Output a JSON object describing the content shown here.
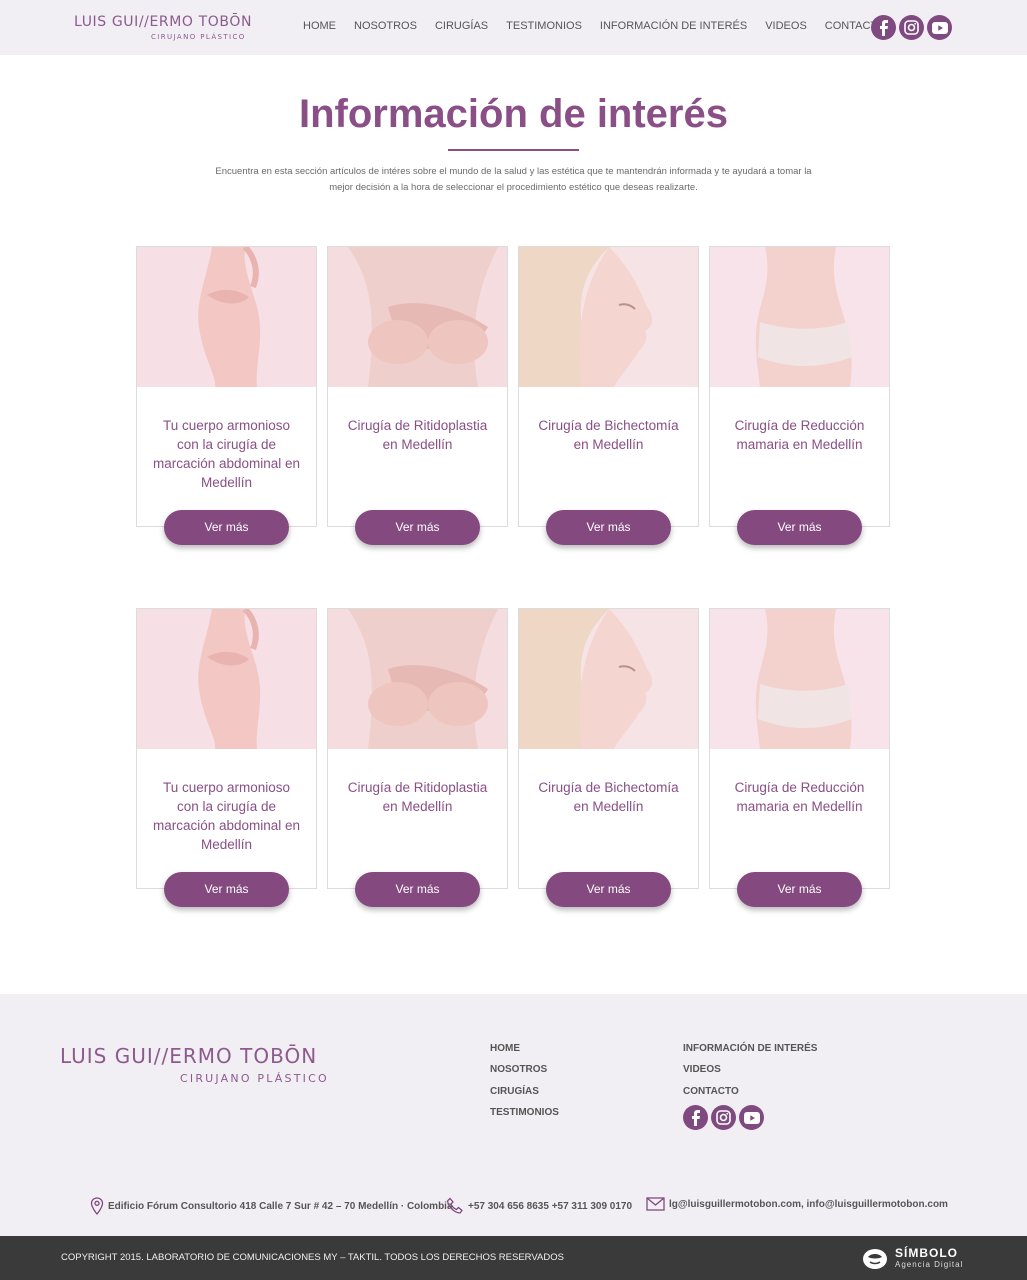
{
  "brand": {
    "name": "LUIS GUI//ERMO TOBŌN",
    "subtitle": "CIRUJANO PLÁSTICO",
    "accent_color": "#894f86",
    "footer_bg": "#f2eff4"
  },
  "nav": {
    "items": [
      "HOME",
      "NOSOTROS",
      "CIRUGÍAS",
      "TESTIMONIOS",
      "INFORMACIÓN DE INTERÉS",
      "VIDEOS",
      "CONTACTO"
    ]
  },
  "social": {
    "icons": [
      "facebook-icon",
      "instagram-icon",
      "youtube-icon"
    ]
  },
  "main": {
    "title": "Información de interés",
    "intro": "Encuentra en esta sección artículos de intéres sobre el mundo de la salud y las estética que te mantendrán informada y te ayudará a tomar la mejor decisión a la hora de seleccionar el procedimiento estético que deseas realizarte.",
    "rows": [
      {
        "cards": [
          {
            "title": "Tu cuerpo armonioso con la cirugía de marcación abdominal en Medellín",
            "button": "Ver más"
          },
          {
            "title": "Cirugía de Ritidoplastia en Medellín",
            "button": "Ver más"
          },
          {
            "title": "Cirugía de Bichectomía en Medellín",
            "button": "Ver más"
          },
          {
            "title": "Cirugía de Reducción mamaria en Medellín",
            "button": "Ver más"
          }
        ]
      },
      {
        "cards": [
          {
            "title": "Tu cuerpo armonioso con la cirugía de marcación abdominal en Medellín",
            "button": "Ver más"
          },
          {
            "title": "Cirugía de Ritidoplastia en Medellín",
            "button": "Ver más"
          },
          {
            "title": "Cirugía de Bichectomía en Medellín",
            "button": "Ver más"
          },
          {
            "title": "Cirugía de Reducción mamaria en Medellín",
            "button": "Ver más"
          }
        ]
      }
    ]
  },
  "footer": {
    "col1": [
      "HOME",
      "NOSOTROS",
      "CIRUGÍAS",
      "TESTIMONIOS"
    ],
    "col2": [
      "INFORMACIÓN DE INTERÉS",
      "VIDEOS",
      "CONTACTO"
    ],
    "address": "Edificio Fórum Consultorio 418 Calle 7 Sur # 42 – 70 Medellín · Colombia",
    "phone": "+57 304 656 8635 +57 311 309 0170",
    "email": "lg@luisguillermotobon.com, info@luisguillermotobon.com",
    "copyright": "COPYRIGHT 2015. LABORATORIO DE COMUNICACIONES MY – TAKTIL. TODOS LOS DERECHOS RESERVADOS",
    "agency_name": "SÍMBOLO",
    "agency_sub": "Agencia Digital"
  }
}
